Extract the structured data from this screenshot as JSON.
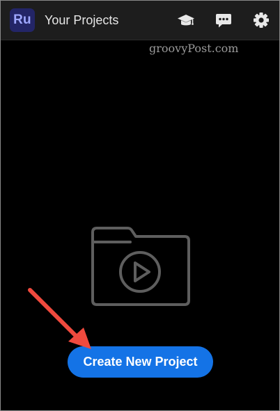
{
  "app": {
    "logo_text": "Ru",
    "title": "Your Projects"
  },
  "header_icons": [
    {
      "name": "tutorials",
      "icon": "graduation-cap-icon"
    },
    {
      "name": "feedback",
      "icon": "speech-bubble-icon"
    },
    {
      "name": "settings",
      "icon": "gear-icon"
    }
  ],
  "watermark": "groovyPost.com",
  "empty_state": {
    "illustration": "folder-play-icon"
  },
  "create_button": {
    "label": "Create New Project"
  },
  "colors": {
    "background": "#000000",
    "header": "#1d1d1d",
    "logo_bg": "#232567",
    "logo_text": "#9ea7ff",
    "accent": "#1473e6",
    "annotation_arrow": "#f04a3e"
  }
}
